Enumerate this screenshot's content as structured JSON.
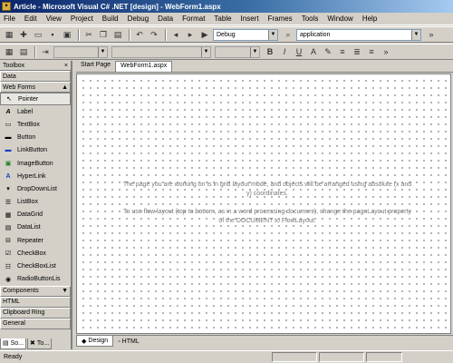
{
  "window": {
    "title": "Article - Microsoft Visual C# .NET [design] - WebForm1.aspx"
  },
  "menu": [
    "File",
    "Edit",
    "View",
    "Project",
    "Build",
    "Debug",
    "Data",
    "Format",
    "Table",
    "Insert",
    "Frames",
    "Tools",
    "Window",
    "Help"
  ],
  "toolbar": {
    "config_combo": "Debug",
    "project_combo": "application"
  },
  "toolbox": {
    "title": "Toolbox",
    "sections_top": [
      "Data",
      "Web Forms"
    ],
    "items": [
      {
        "label": "Pointer",
        "icon": "pointer-icon"
      },
      {
        "label": "Label",
        "icon": "label-icon"
      },
      {
        "label": "TextBox",
        "icon": "textbox-icon"
      },
      {
        "label": "Button",
        "icon": "button-icon"
      },
      {
        "label": "LinkButton",
        "icon": "linkbutton-icon"
      },
      {
        "label": "ImageButton",
        "icon": "imagebutton-icon"
      },
      {
        "label": "HyperLink",
        "icon": "hyperlink-icon"
      },
      {
        "label": "DropDownList",
        "icon": "dropdown-icon"
      },
      {
        "label": "ListBox",
        "icon": "listbox-icon"
      },
      {
        "label": "DataGrid",
        "icon": "datagrid-icon"
      },
      {
        "label": "DataList",
        "icon": "datalist-icon"
      },
      {
        "label": "Repeater",
        "icon": "repeater-icon"
      },
      {
        "label": "CheckBox",
        "icon": "checkbox-icon"
      },
      {
        "label": "CheckBoxList",
        "icon": "checkboxlist-icon"
      },
      {
        "label": "RadioButtonLis",
        "icon": "radiobuttonlist-icon"
      }
    ],
    "sections_bottom": [
      "Components",
      "HTML",
      "Clipboard Ring",
      "General"
    ],
    "bottom_tabs": [
      "So...",
      "To..."
    ]
  },
  "document": {
    "tabs": [
      "Start Page",
      "WebForm1.aspx"
    ],
    "message_line1": "The page you are working on is in grid layout mode, and objects will be arranged using absolute (x and y) coordinates.",
    "message_line2": "To use flow layout (top to bottom, as in a word processing document), change the pageLayout property of the DOCUMENT to FlowLayout.",
    "view_tabs": [
      "Design",
      "HTML"
    ]
  },
  "status": {
    "text": "Ready"
  }
}
